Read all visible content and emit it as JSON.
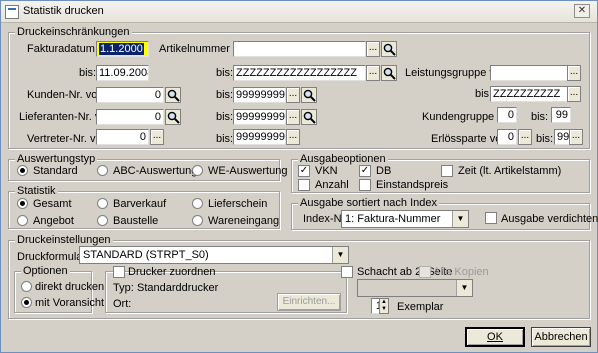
{
  "window": {
    "title": "Statistik drucken"
  },
  "group_restrictions": {
    "title": "Druckeinschränkungen",
    "fakturadatum_label": "Fakturadatum von:",
    "fakturadatum_from": "1.1.2000",
    "fakturadatum_to": "11.09.2008",
    "bis": "bis:",
    "artikelnummer_label": "Artikelnummer von:",
    "artikelnummer_from": "",
    "artikelnummer_to": "ZZZZZZZZZZZZZZZZZZ",
    "leistungsgruppe_label": "Leistungsgruppe von:",
    "leistungsgruppe_from": "",
    "leistungsgruppe_to": "ZZZZZZZZZZ",
    "kunden_label": "Kunden-Nr. von:",
    "kunden_from": "0",
    "kunden_to": "99999999",
    "lieferanten_label": "Lieferanten-Nr. von:",
    "lieferanten_from": "0",
    "lieferanten_to": "99999999",
    "vertreter_label": "Vertreter-Nr. von:",
    "vertreter_from": "0",
    "vertreter_to": "99999999",
    "kundengruppe_label": "Kundengruppe von:",
    "kundengruppe_from": "0",
    "kundengruppe_to": "99",
    "erloesparte_label": "Erlössparte von:",
    "erloesparte_from": "0",
    "erloesparte_to": "99",
    "browse": "..."
  },
  "auswertungstyp": {
    "title": "Auswertungstyp",
    "options": [
      "Standard",
      "ABC-Auswertung",
      "WE-Auswertung"
    ],
    "selected": "Standard"
  },
  "statistik": {
    "title": "Statistik",
    "options": [
      "Gesamt",
      "Barverkauf",
      "Lieferschein",
      "Angebot",
      "Baustelle",
      "Wareneingang"
    ],
    "selected": "Gesamt"
  },
  "ausgabeoptionen": {
    "title": "Ausgabeoptionen",
    "vkn": "VKN",
    "db": "DB",
    "zeit": "Zeit (lt. Artikelstamm)",
    "anzahl": "Anzahl",
    "einstandspreis": "Einstandspreis",
    "checked": [
      "VKN",
      "DB"
    ]
  },
  "sortierung": {
    "title": "Ausgabe sortiert nach Index",
    "index_label": "Index-Nr.:",
    "index_value": "1: Faktura-Nummer",
    "verdichten": "Ausgabe verdichten"
  },
  "druckeinstellungen": {
    "title": "Druckeinstellungen",
    "formular_label": "Druckformular:",
    "formular_value": "STANDARD (STRPT_S0)",
    "optionen_title": "Optionen",
    "direkt": "direkt drucken",
    "voransicht": "mit Voransicht",
    "selected": "mit Voransicht",
    "drucker_zuordnen": "Drucker zuordnen",
    "typ_label": "Typ:",
    "typ_value": "Standarddrucker",
    "ort_label": "Ort:",
    "einrichten": "Einrichten...",
    "schacht": "Schacht ab 2. Seite",
    "alle_kopien": "Alle Kopien",
    "exemplar_count": "1",
    "exemplar_label": "Exemplar"
  },
  "buttons": {
    "ok": "OK",
    "abbrechen": "Abbrechen"
  }
}
